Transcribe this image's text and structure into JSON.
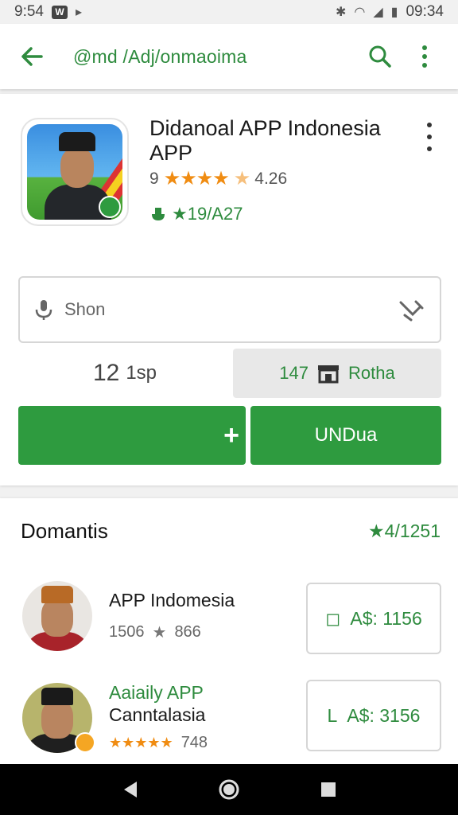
{
  "status_bar": {
    "time_left": "9:54",
    "time_right": "09:34",
    "badge": "W"
  },
  "app_bar": {
    "path": "@md /Adj/onmaoima"
  },
  "app": {
    "title": "Didanoal APP Indonesia APP",
    "rating_prefix": "9",
    "stars": "★★★★",
    "rating_value": "4.26",
    "downloads": "★19/A27"
  },
  "search": {
    "placeholder": "Shon"
  },
  "stats": {
    "left_big": "12",
    "left_small": "1sp",
    "right_value": "147",
    "right_label": "Rotha"
  },
  "buttons": {
    "plus_label": "+",
    "undua_label": "UNDua"
  },
  "section": {
    "title": "Domantis",
    "count": "★4/1251"
  },
  "list": [
    {
      "name_line1": "APP Indomesia",
      "name_line2": "",
      "meta_num": "1506",
      "meta_rating": "866",
      "price": "A$: 1156",
      "price_icon": "◻"
    },
    {
      "name_line1": "Aaiaily APP",
      "name_line2": "Canntalasia",
      "meta_num": "★★★★★",
      "meta_rating": "748",
      "price": "A$: 3156",
      "price_icon": "L"
    }
  ],
  "colors": {
    "accent": "#2e9b3f",
    "star": "#f08c12"
  }
}
